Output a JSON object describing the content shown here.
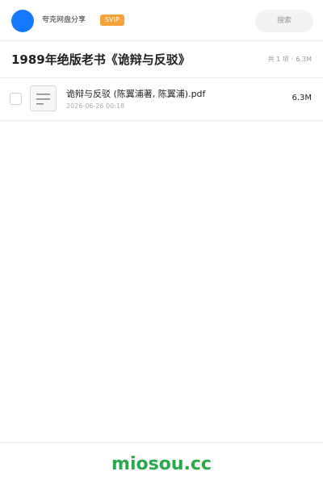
{
  "header": {
    "user_name": "夸克网盘分享",
    "badge": "SVIP",
    "search_placeholder": "搜索"
  },
  "share": {
    "title": "1989年绝版老书《诡辩与反驳》",
    "count_text": "共 1 项",
    "separator": "·",
    "total_size": "6.3M"
  },
  "files": [
    {
      "name": "诡辩与反驳 (陈翼浦著, 陈翼浦).pdf",
      "date": "2026-06-26 00:18",
      "size": "6.3M",
      "icon": "document-icon"
    }
  ],
  "footer": {
    "watermark": "miosou.cc"
  },
  "colors": {
    "avatar": "#1677ff",
    "badge": "#f6a23a",
    "watermark": "#2aa94a"
  }
}
